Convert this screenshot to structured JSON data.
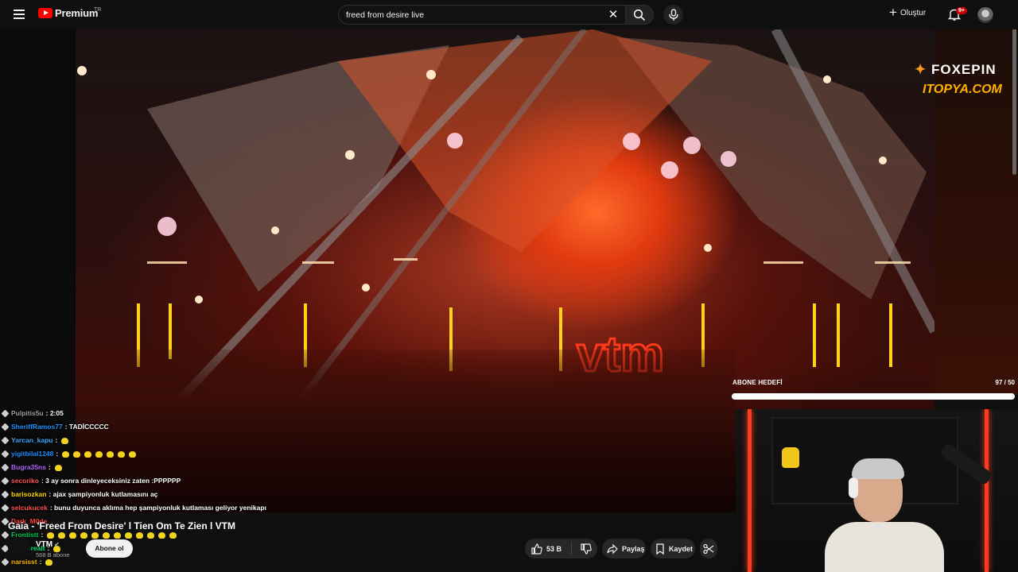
{
  "topbar": {
    "brand": "Premium",
    "region": "TR",
    "search_value": "freed from desire live",
    "create_label": "Oluştur",
    "notifications_badge": "9+"
  },
  "video": {
    "watermark_line1": "FOXEPIN",
    "watermark_line2": "ITOPYA.COM"
  },
  "goal": {
    "label": "ABONE HEDEFİ",
    "count": "97 / 50",
    "progress": 1.0
  },
  "chat": {
    "messages": [
      {
        "user": "Pulpitis5u",
        "text": ": 2:05",
        "color": "#9aa0a6"
      },
      {
        "user": "SheriffRamos77",
        "text": ": TADİCCCCC",
        "color": "#1e90ff"
      },
      {
        "user": "Yarcan_kapu",
        "text": ":",
        "color": "#3ea6ff"
      },
      {
        "user": "yigitbilal1248",
        "text": ":",
        "color": "#1e90ff"
      },
      {
        "user": "Bugra35ns",
        "text": ":",
        "color": "#b266ff"
      },
      {
        "user": "secoriko",
        "text": ": 3 ay sonra dinleyeceksiniz zaten :PPPPPP",
        "color": "#ff5555"
      },
      {
        "user": "barisozkan",
        "text": ": ajax şampiyonluk kutlamasını aç",
        "color": "#ffd700"
      },
      {
        "user": "selcukucek",
        "text": ": bunu duyunca aklıma hep şampiyonluk kutlaması geliyor yenikapı",
        "color": "#ff4f4f"
      },
      {
        "user": "Dark_M0de",
        "text": "",
        "color": "#ff4444"
      },
      {
        "user": "Frontistt",
        "text": ":",
        "color": "#00c853"
      },
      {
        "user": "enesdrealt",
        "text": ":",
        "color": "#00e676"
      },
      {
        "user": "narsisst",
        "text": ":",
        "color": "#ffb300"
      }
    ]
  },
  "meta": {
    "title": "Gaia - 'Freed From Desire' l Tien Om Te Zien l VTM",
    "channel": "VTM",
    "subscribers": "568 B abone",
    "subscribe_label": "Abone ol"
  },
  "actions": {
    "likes": "53 B",
    "share": "Paylaş",
    "save": "Kaydet"
  },
  "icons": {
    "menu": "menu-icon",
    "search": "search-icon",
    "mic": "mic-icon",
    "bell": "bell-icon",
    "like": "thumbs-up-icon",
    "dislike": "thumbs-down-icon",
    "share": "share-icon",
    "save": "bookmark-icon",
    "clip": "scissors-icon"
  }
}
